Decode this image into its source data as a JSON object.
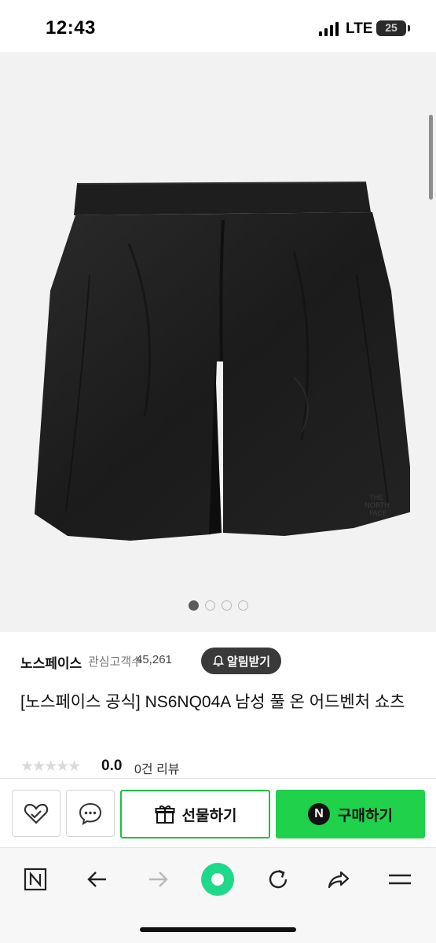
{
  "status_bar": {
    "time": "12:43",
    "network": "LTE",
    "battery_level": "25"
  },
  "product_image": {
    "alt": "",
    "carousel": {
      "total": 4,
      "active_index": 0
    }
  },
  "brand": {
    "name": "노스페이스",
    "fans_label": "관심고객수",
    "fans_count": "45,261",
    "alert_button": "알림받기"
  },
  "product": {
    "title": "[노스페이스 공식] NS6NQ04A 남성 풀 온 어드벤처 쇼츠"
  },
  "rating": {
    "stars": "★★★★★",
    "score": "0.0",
    "reviews": "0건 리뷰"
  },
  "actions": {
    "gift_label": "선물하기",
    "buy_label": "구매하기",
    "buy_badge": "N"
  },
  "browser_toolbar": {
    "icons": [
      "naver-n-icon",
      "back-arrow-icon",
      "forward-arrow-icon",
      "green-dot-icon",
      "refresh-icon",
      "share-icon",
      "menu-icon"
    ]
  },
  "colors": {
    "accent_green": "#1fd14b",
    "dark_button": "#3a3a3a",
    "image_bg": "#f2f2f2"
  }
}
